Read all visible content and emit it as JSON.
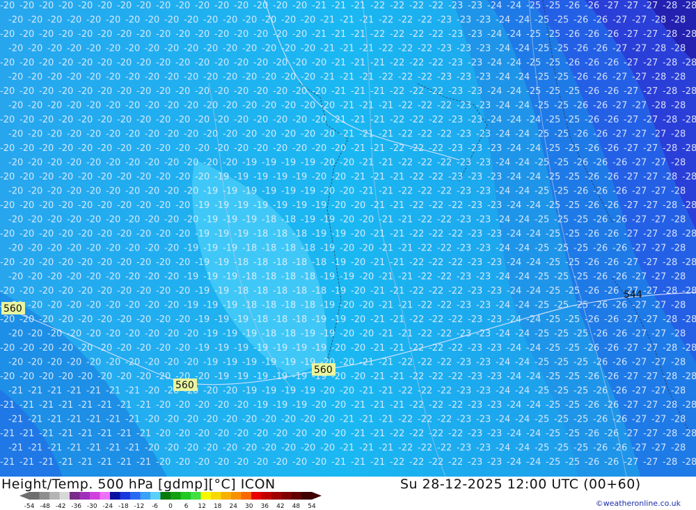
{
  "map": {
    "background_color": "#1ab8f2",
    "temperature_contours": [
      {
        "value": "-18",
        "color": "#86d4f8"
      },
      {
        "value": "-19",
        "color": "#3cc6f6"
      },
      {
        "value": "-20",
        "color": "#20aeec"
      },
      {
        "value": "-21",
        "color": "#1d8fe6"
      },
      {
        "value": "-22",
        "color": "#1f72e6"
      },
      {
        "value": "-23",
        "color": "#2358e6"
      },
      {
        "value": "-24",
        "color": "#2448e4"
      },
      {
        "value": "-25",
        "color": "#2a3ad8"
      },
      {
        "value": "-26",
        "color": "#2a2cc8"
      },
      {
        "value": "-27",
        "color": "#2620b4"
      },
      {
        "value": "-28",
        "color": "#221aa0"
      }
    ],
    "height_labels": [
      {
        "text": "560"
      },
      {
        "text": "560"
      },
      {
        "text": "560"
      },
      {
        "text": "544"
      }
    ]
  },
  "footer": {
    "title": "Height/Temp. 500 hPa [gdmp][°C] ICON",
    "datetime": "Su 28-12-2025 12:00 UTC (00+60)",
    "credit": "©weatheronline.co.uk",
    "scale_ticks": [
      "-54",
      "-48",
      "-42",
      "-36",
      "-30",
      "-24",
      "-18",
      "-12",
      "-6",
      "0",
      "6",
      "12",
      "18",
      "24",
      "30",
      "36",
      "42",
      "48",
      "54"
    ],
    "scale_colors": [
      "#6e6e6e",
      "#8e8e8e",
      "#b4b4b4",
      "#d8d8d8",
      "#7a2a8a",
      "#a030b8",
      "#d040e0",
      "#f070f8",
      "#0a10a0",
      "#1838e0",
      "#2868f0",
      "#3aa0f8",
      "#58d0fa",
      "#087a08",
      "#10a010",
      "#20c820",
      "#40e040",
      "#f8f800",
      "#f8d800",
      "#f8b000",
      "#f89000",
      "#f86800",
      "#e80000",
      "#c00000",
      "#a00000",
      "#800000",
      "#600000",
      "#400000"
    ]
  }
}
